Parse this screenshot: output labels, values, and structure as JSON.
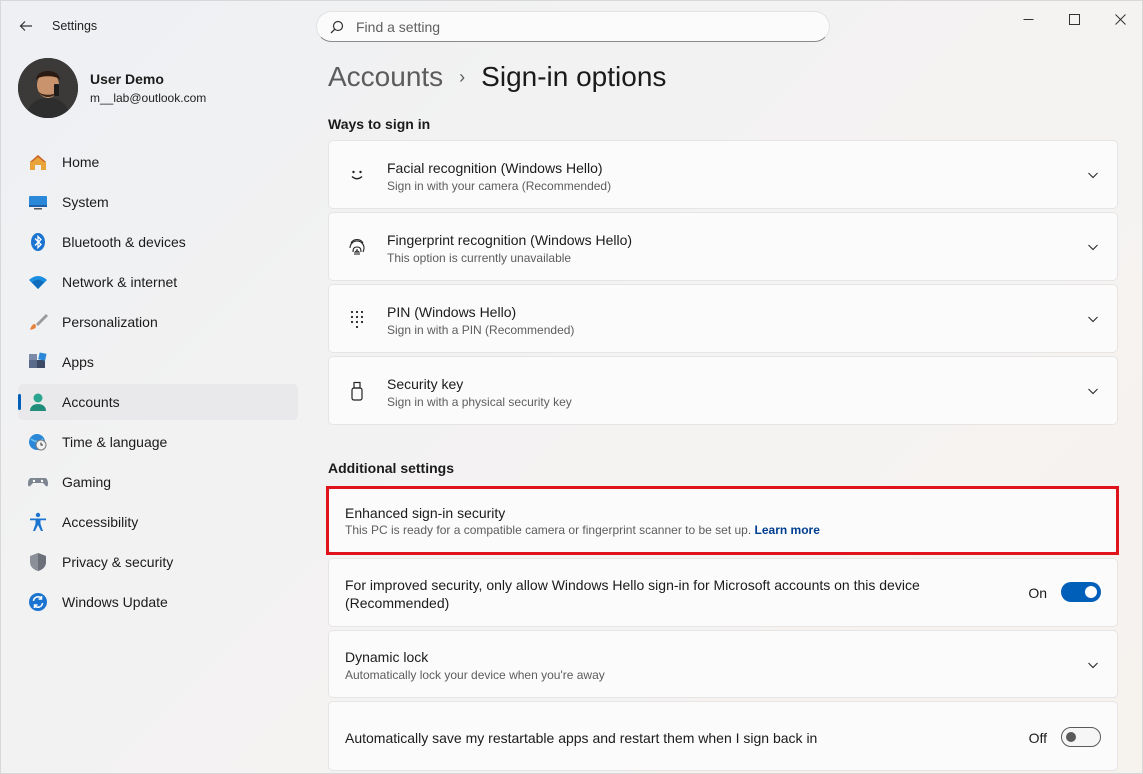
{
  "window": {
    "title": "Settings"
  },
  "search": {
    "placeholder": "Find a setting"
  },
  "profile": {
    "name": "User Demo",
    "email": "m__lab@outlook.com"
  },
  "sidebar": {
    "items": [
      {
        "label": "Home",
        "icon": "home-icon"
      },
      {
        "label": "System",
        "icon": "monitor-icon"
      },
      {
        "label": "Bluetooth & devices",
        "icon": "bluetooth-icon"
      },
      {
        "label": "Network & internet",
        "icon": "wifi-icon"
      },
      {
        "label": "Personalization",
        "icon": "brush-icon"
      },
      {
        "label": "Apps",
        "icon": "apps-icon"
      },
      {
        "label": "Accounts",
        "icon": "person-icon",
        "active": true
      },
      {
        "label": "Time & language",
        "icon": "globe-clock-icon"
      },
      {
        "label": "Gaming",
        "icon": "gamepad-icon"
      },
      {
        "label": "Accessibility",
        "icon": "accessibility-icon"
      },
      {
        "label": "Privacy & security",
        "icon": "shield-icon"
      },
      {
        "label": "Windows Update",
        "icon": "update-icon"
      }
    ]
  },
  "breadcrumb": {
    "parent": "Accounts",
    "separator": "›",
    "current": "Sign-in options"
  },
  "ways_to_sign_in": {
    "title": "Ways to sign in",
    "items": [
      {
        "title": "Facial recognition (Windows Hello)",
        "desc": "Sign in with your camera (Recommended)",
        "icon": "face-icon"
      },
      {
        "title": "Fingerprint recognition (Windows Hello)",
        "desc": "This option is currently unavailable",
        "icon": "fingerprint-icon"
      },
      {
        "title": "PIN (Windows Hello)",
        "desc": "Sign in with a PIN (Recommended)",
        "icon": "keypad-icon"
      },
      {
        "title": "Security key",
        "desc": "Sign in with a physical security key",
        "icon": "usb-key-icon"
      }
    ]
  },
  "additional": {
    "title": "Additional settings",
    "enhanced": {
      "title": "Enhanced sign-in security",
      "desc": "This PC is ready for a compatible camera or fingerprint scanner to be set up.",
      "link": "Learn more"
    },
    "hello_only": {
      "title_line1": "For improved security, only allow Windows Hello sign-in for Microsoft accounts on this device",
      "title_line2": "(Recommended)",
      "state": "On"
    },
    "dynamic_lock": {
      "title": "Dynamic lock",
      "desc": "Automatically lock your device when you're away"
    },
    "restart_apps": {
      "title": "Automatically save my restartable apps and restart them when I sign back in",
      "state": "Off"
    }
  },
  "colors": {
    "accent": "#005fb8",
    "highlight": "#e0121c",
    "link": "#003e92"
  }
}
